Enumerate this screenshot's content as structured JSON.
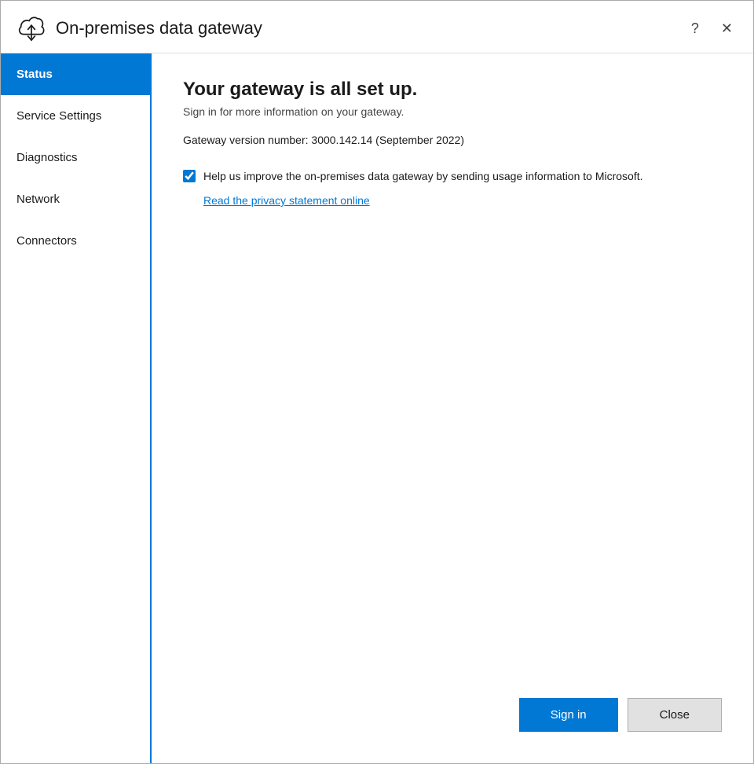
{
  "window": {
    "title": "On-premises data gateway",
    "help_btn": "?",
    "close_btn": "✕"
  },
  "sidebar": {
    "items": [
      {
        "id": "status",
        "label": "Status",
        "active": true
      },
      {
        "id": "service-settings",
        "label": "Service Settings",
        "active": false
      },
      {
        "id": "diagnostics",
        "label": "Diagnostics",
        "active": false
      },
      {
        "id": "network",
        "label": "Network",
        "active": false
      },
      {
        "id": "connectors",
        "label": "Connectors",
        "active": false
      }
    ]
  },
  "content": {
    "heading": "Your gateway is all set up.",
    "subtitle": "Sign in for more information on your gateway.",
    "version": "Gateway version number: 3000.142.14 (September 2022)",
    "checkbox_label": "Help us improve the on-premises data gateway by sending usage information to Microsoft.",
    "privacy_link": "Read the privacy statement online",
    "checkbox_checked": true
  },
  "footer": {
    "signin_label": "Sign in",
    "close_label": "Close"
  },
  "colors": {
    "accent": "#0078d4",
    "active_nav_bg": "#0078d4",
    "active_nav_text": "#ffffff"
  }
}
